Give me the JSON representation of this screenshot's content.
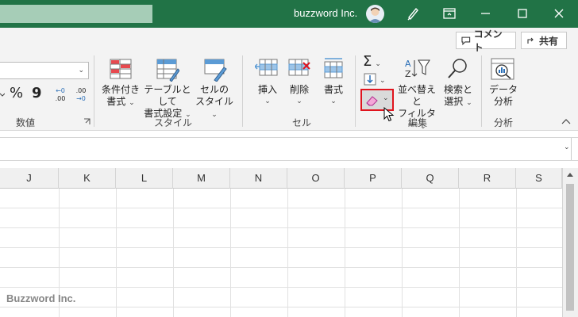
{
  "titlebar": {
    "account_name": "buzzword Inc."
  },
  "ribbon_top": {
    "comment_label": "コメント",
    "share_label": "共有"
  },
  "number_group": {
    "percent_symbol": "%",
    "comma_symbol": "9",
    "inc_decimal": ".00",
    "dec_decimal": ".00",
    "label": "数値"
  },
  "styles_group": {
    "conditional_line1": "条件付き",
    "conditional_line2": "書式",
    "table_line1": "テーブルとして",
    "table_line2": "書式設定",
    "cell_style_line1": "セルの",
    "cell_style_line2": "スタイル",
    "label": "スタイル"
  },
  "cells_group": {
    "insert_label": "挿入",
    "delete_label": "削除",
    "format_label": "書式",
    "label": "セル"
  },
  "editing_group": {
    "sort_line1": "並べ替えと",
    "sort_line2": "フィルター",
    "find_line1": "検索と",
    "find_line2": "選択",
    "label": "編集"
  },
  "analysis_group": {
    "data_line1": "データ",
    "data_line2": "分析",
    "label": "分析"
  },
  "grid": {
    "columns": [
      "J",
      "K",
      "L",
      "M",
      "N",
      "O",
      "P",
      "Q",
      "R",
      "S"
    ]
  },
  "watermark": "Buzzword Inc.",
  "colors": {
    "title_bar": "#217346",
    "highlight": "#e0141e"
  }
}
